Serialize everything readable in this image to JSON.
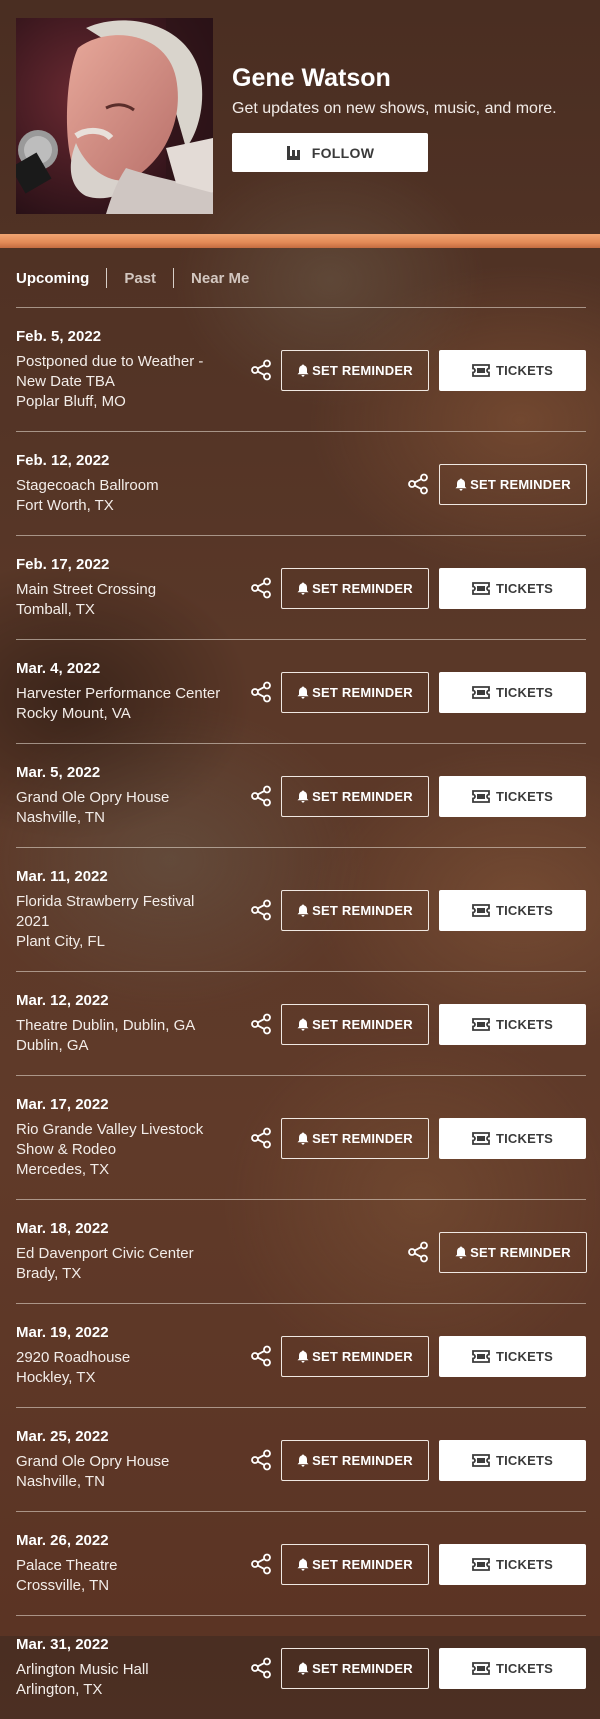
{
  "artist": {
    "name": "Gene Watson",
    "subtitle": "Get updates on new shows, music, and more.",
    "follow_label": "FOLLOW"
  },
  "tabs": [
    {
      "label": "Upcoming",
      "active": true
    },
    {
      "label": "Past",
      "active": false
    },
    {
      "label": "Near Me",
      "active": false
    }
  ],
  "buttons": {
    "reminder_label": "SET REMINDER",
    "tickets_label": "TICKETS"
  },
  "events": [
    {
      "date": "Feb. 5, 2022",
      "venue_lines": [
        "Postponed due to Weather -",
        "New Date TBA"
      ],
      "location": "Poplar Bluff, MO",
      "has_tickets": true
    },
    {
      "date": "Feb. 12, 2022",
      "venue_lines": [
        "Stagecoach Ballroom"
      ],
      "location": "Fort Worth, TX",
      "has_tickets": false
    },
    {
      "date": "Feb. 17, 2022",
      "venue_lines": [
        "Main Street Crossing"
      ],
      "location": "Tomball, TX",
      "has_tickets": true
    },
    {
      "date": "Mar. 4, 2022",
      "venue_lines": [
        "Harvester Performance Center"
      ],
      "location": "Rocky Mount, VA",
      "has_tickets": true
    },
    {
      "date": "Mar. 5, 2022",
      "venue_lines": [
        "Grand Ole Opry House"
      ],
      "location": "Nashville, TN",
      "has_tickets": true
    },
    {
      "date": "Mar. 11, 2022",
      "venue_lines": [
        "Florida Strawberry Festival",
        "2021"
      ],
      "location": "Plant City, FL",
      "has_tickets": true
    },
    {
      "date": "Mar. 12, 2022",
      "venue_lines": [
        "Theatre Dublin, Dublin, GA"
      ],
      "location": "Dublin, GA",
      "has_tickets": true
    },
    {
      "date": "Mar. 17, 2022",
      "venue_lines": [
        "Rio Grande Valley Livestock",
        "Show & Rodeo"
      ],
      "location": "Mercedes, TX",
      "has_tickets": true
    },
    {
      "date": "Mar. 18, 2022",
      "venue_lines": [
        "Ed Davenport Civic Center"
      ],
      "location": "Brady, TX",
      "has_tickets": false
    },
    {
      "date": "Mar. 19, 2022",
      "venue_lines": [
        "2920 Roadhouse"
      ],
      "location": "Hockley, TX",
      "has_tickets": true
    },
    {
      "date": "Mar. 25, 2022",
      "venue_lines": [
        "Grand Ole Opry House"
      ],
      "location": "Nashville, TN",
      "has_tickets": true
    },
    {
      "date": "Mar. 26, 2022",
      "venue_lines": [
        "Palace Theatre"
      ],
      "location": "Crossville, TN",
      "has_tickets": true
    },
    {
      "date": "Mar. 31, 2022",
      "venue_lines": [
        "Arlington Music Hall"
      ],
      "location": "Arlington, TX",
      "has_tickets": true
    }
  ],
  "icons": {
    "share": "share-icon",
    "bell": "bell-icon",
    "ticket": "ticket-icon",
    "follow": "bandsintown-logo-icon"
  },
  "colors": {
    "accent_bar": "#e38a56",
    "background": "#5a3828",
    "button_white": "#ffffff"
  }
}
